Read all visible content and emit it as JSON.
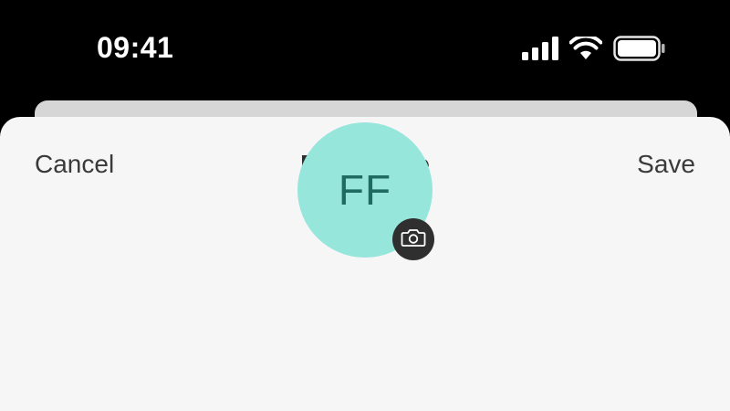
{
  "status_bar": {
    "time": "09:41",
    "icons": [
      "cellular-signal-icon",
      "wifi-icon",
      "battery-icon"
    ]
  },
  "navigation": {
    "cancel_label": "Cancel",
    "title": "Edit Payee",
    "save_label": "Save"
  },
  "avatar": {
    "initials": "FF",
    "background_color": "#96e6dc",
    "badge_icon": "camera-icon"
  },
  "colors": {
    "sheet_background": "#f6f6f6",
    "avatar_background": "#96e6dc",
    "avatar_text": "#1f6b62",
    "badge_background": "#2f2f2f"
  }
}
